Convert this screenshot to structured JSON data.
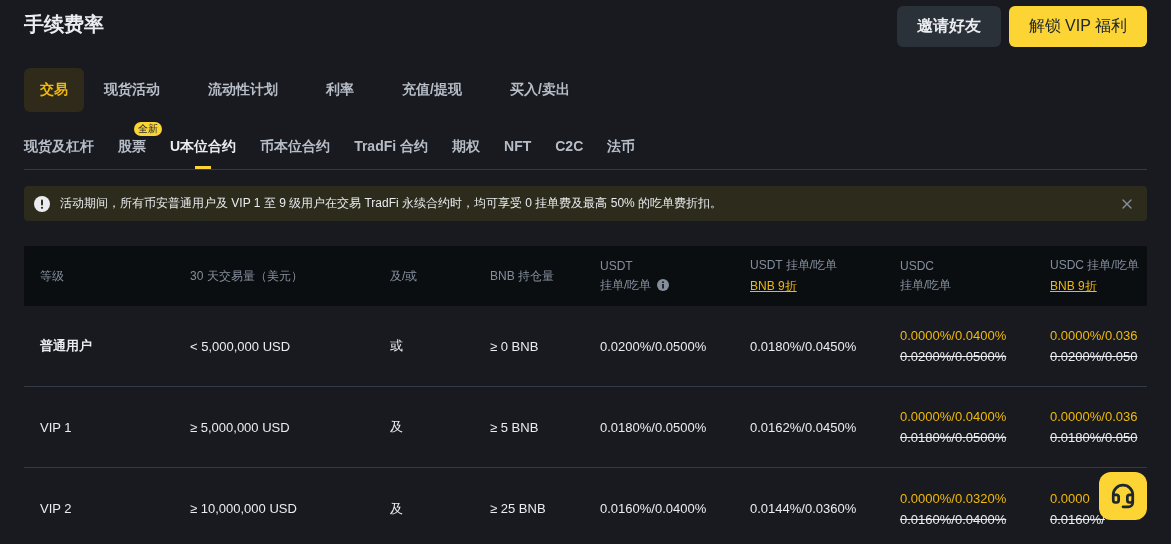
{
  "page_title": "手续费率",
  "header_buttons": [
    {
      "label": "邀请好友",
      "kind": "secondary"
    },
    {
      "label": "解锁 VIP 福利",
      "kind": "primary"
    }
  ],
  "main_tabs": [
    {
      "label": "交易",
      "selected": true
    },
    {
      "label": "现货活动",
      "selected": false
    },
    {
      "label": "流动性计划",
      "selected": false
    },
    {
      "label": "利率",
      "selected": false
    },
    {
      "label": "充值/提现",
      "selected": false
    },
    {
      "label": "买入/卖出",
      "selected": false
    }
  ],
  "sub_tabs": [
    {
      "label": "现货及杠杆",
      "selected": false
    },
    {
      "label": "股票",
      "selected": false,
      "badge": "全新"
    },
    {
      "label": "U本位合约",
      "selected": true
    },
    {
      "label": "币本位合约",
      "selected": false
    },
    {
      "label": "TradFi 合约",
      "selected": false
    },
    {
      "label": "期权",
      "selected": false
    },
    {
      "label": "NFT",
      "selected": false
    },
    {
      "label": "C2C",
      "selected": false
    },
    {
      "label": "法币",
      "selected": false
    }
  ],
  "notice": {
    "text": "活动期间，所有币安普通用户及 VIP 1 至 9 级用户在交易 TradFi 永续合约时，均可享受 0 挂单费及最高 50% 的吃单费折扣。"
  },
  "table": {
    "columns": [
      {
        "label": "等级"
      },
      {
        "label": "30 天交易量（美元）"
      },
      {
        "label": "及/或"
      },
      {
        "label": "BNB 持仓量"
      },
      {
        "label": "USDT",
        "sublabel": "挂单/吃单",
        "info": true
      },
      {
        "label": "USDT 挂单/吃单",
        "link": "BNB 9折"
      },
      {
        "label": "USDC",
        "sublabel": "挂单/吃单"
      },
      {
        "label": "USDC 挂单/吃单",
        "link": "BNB 9折"
      }
    ],
    "rows": [
      {
        "cells": [
          {
            "kind": "plain",
            "text": "普通用户"
          },
          {
            "kind": "plain",
            "text": "< 5,000,000 USD"
          },
          {
            "kind": "plain",
            "text": "或"
          },
          {
            "kind": "plain",
            "text": "≥ 0 BNB"
          },
          {
            "kind": "plain",
            "text": "0.0200%/0.0500%"
          },
          {
            "kind": "plain",
            "text": "0.0180%/0.0450%"
          },
          {
            "kind": "promo",
            "promo": "0.0000%/0.0400%",
            "original": "0.0200%/0.0500%"
          },
          {
            "kind": "promo",
            "promo": "0.0000%/0.036",
            "original": "0.0200%/0.050"
          }
        ]
      },
      {
        "cells": [
          {
            "kind": "plain",
            "text": "VIP 1"
          },
          {
            "kind": "plain",
            "text": "≥ 5,000,000 USD"
          },
          {
            "kind": "plain",
            "text": "及"
          },
          {
            "kind": "plain",
            "text": "≥ 5 BNB"
          },
          {
            "kind": "plain",
            "text": "0.0180%/0.0500%"
          },
          {
            "kind": "plain",
            "text": "0.0162%/0.0450%"
          },
          {
            "kind": "promo",
            "promo": "0.0000%/0.0400%",
            "original": "0.0180%/0.0500%"
          },
          {
            "kind": "promo",
            "promo": "0.0000%/0.036",
            "original": "0.0180%/0.050"
          }
        ]
      },
      {
        "cells": [
          {
            "kind": "plain",
            "text": "VIP 2"
          },
          {
            "kind": "plain",
            "text": "≥ 10,000,000 USD"
          },
          {
            "kind": "plain",
            "text": "及"
          },
          {
            "kind": "plain",
            "text": "≥ 25 BNB"
          },
          {
            "kind": "plain",
            "text": "0.0160%/0.0400%"
          },
          {
            "kind": "plain",
            "text": "0.0144%/0.0360%"
          },
          {
            "kind": "promo",
            "promo": "0.0000%/0.0320%",
            "original": "0.0160%/0.0400%"
          },
          {
            "kind": "promo",
            "promo": "0.0000",
            "original": "0.0160%/"
          }
        ]
      }
    ]
  }
}
